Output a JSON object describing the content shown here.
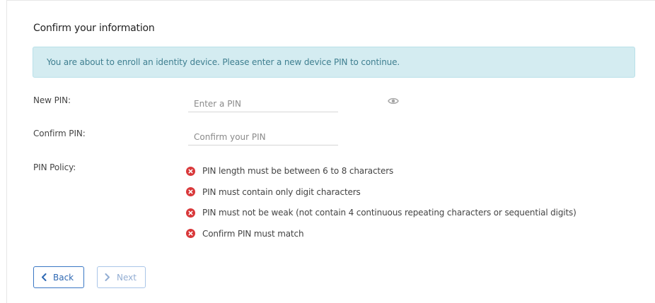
{
  "form": {
    "title": "Confirm your information",
    "alert": "You are about to enroll an identity device. Please enter a new device PIN to continue.",
    "fields": {
      "new_pin": {
        "label": "New PIN:",
        "placeholder": "Enter a PIN"
      },
      "confirm_pin": {
        "label": "Confirm PIN:",
        "placeholder": "Confirm your PIN"
      }
    },
    "show_pin_icon": "eye-icon",
    "policy": {
      "label": "PIN Policy:",
      "status_icon": "x-circle-icon",
      "status_color": "#d9383a",
      "rules": [
        "PIN length must be between 6 to 8 characters",
        "PIN must contain only digit characters",
        "PIN must not be weak (not contain 4 continuous repeating characters or sequential digits)",
        "Confirm PIN must match"
      ]
    }
  },
  "navigation": {
    "back_label": "Back",
    "back_icon": "chevron-left-icon",
    "next_label": "Next",
    "next_icon": "chevron-right-icon",
    "accent_color": "#3a77c4"
  }
}
